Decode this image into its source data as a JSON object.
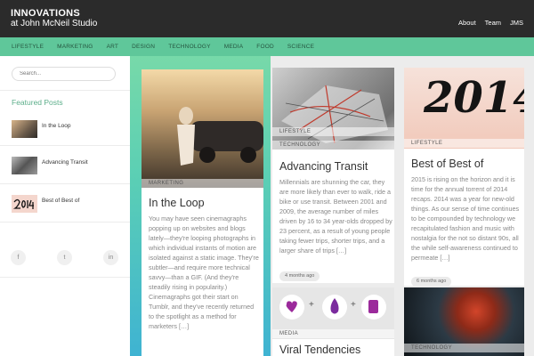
{
  "header": {
    "title": "INNOVATIONS",
    "subtitle": "at John McNeil Studio",
    "nav": [
      "About",
      "Team",
      "JMS"
    ]
  },
  "categories": [
    "Lifestyle",
    "Marketing",
    "Art",
    "Design",
    "Technology",
    "Media",
    "Food",
    "Science"
  ],
  "sidebar": {
    "search_placeholder": "Search...",
    "featured_title": "Featured Posts",
    "featured": [
      "In the Loop",
      "Advancing Transit",
      "Best of Best of"
    ],
    "social": [
      "f",
      "t",
      "in"
    ]
  },
  "cards": {
    "loop": {
      "tag": "Marketing",
      "title": "In the Loop",
      "body": "You may have seen cinemagraphs popping up on websites and blogs lately—they're looping photographs in which individual instants of motion are isolated against a static image. They're subtler—and require more technical savvy—than a GIF. (And they're steadily rising in popularity.) Cinemagraphs got their start on Tumblr, and they've recently returned to the spotlight as a method for marketers […]"
    },
    "transit": {
      "tag1": "Lifestyle",
      "tag2": "Technology",
      "title": "Advancing Transit",
      "body": "Millennials are shunning the car, they are more likely than ever to walk, ride a bike or use transit. Between 2001 and 2009, the average number of miles driven by 16 to 34 year-olds dropped by 23 percent, as a result of young people taking fewer trips, shorter trips, and a larger share of trips […]",
      "ago": "4 months ago"
    },
    "best": {
      "image_text": "2014",
      "tag": "Lifestyle",
      "title": "Best of Best of",
      "body": "2015 is rising on the horizon and it is time for the annual torrent of 2014 recaps. 2014 was a year for new-old things. As our sense of time continues to be compounded by technology we recapitulated fashion and music with nostalgia for the not so distant 90s, all the while self-awareness continued to permeate […]",
      "ago": "6 months ago"
    },
    "viral": {
      "tag": "Media",
      "title": "Viral Tendencies",
      "plus": "+"
    },
    "tech": {
      "tag": "Technology"
    }
  },
  "colors": {
    "accent": "#5fc79a",
    "header_bg": "#2b2b2b",
    "featured_title": "#5cae8a"
  }
}
